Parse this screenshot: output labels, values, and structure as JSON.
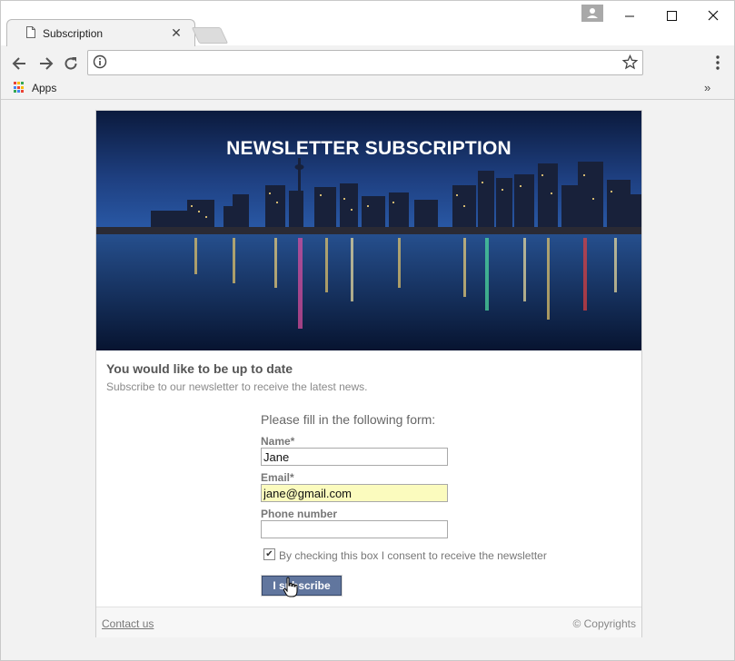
{
  "browser": {
    "tab_title": "Subscription",
    "bookmarks_apps_label": "Apps",
    "icons": [
      "document-icon",
      "close-icon",
      "back-arrow-icon",
      "forward-arrow-icon",
      "reload-icon",
      "info-icon",
      "star-icon",
      "menu-icon",
      "apps-icon",
      "chevron-double-right-icon",
      "profile-icon",
      "minimize-icon",
      "maximize-icon",
      "window-close-icon"
    ],
    "apps_colors": [
      "#ea4335",
      "#fbbc05",
      "#34a853",
      "#4285f4",
      "#ea4335",
      "#fbbc05",
      "#34a853",
      "#4285f4",
      "#ea4335"
    ]
  },
  "hero": {
    "title": "NEWSLETTER SUBSCRIPTION"
  },
  "intro": {
    "heading": "You would like to be up to date",
    "subtitle": "Subscribe to our newsletter to receive the latest news."
  },
  "form": {
    "intro": "Please fill in the following form:",
    "name_label": "Name*",
    "name_value": "Jane",
    "email_label": "Email*",
    "email_value": "jane@gmail.com",
    "phone_label": "Phone number",
    "phone_value": "",
    "consent_label": "By checking this box I consent to receive the newsletter",
    "consent_checked": true,
    "submit_label": "I subscribe",
    "button_color": "#61769e"
  },
  "footer": {
    "contact": "Contact us",
    "copyright": "© Copyrights"
  }
}
